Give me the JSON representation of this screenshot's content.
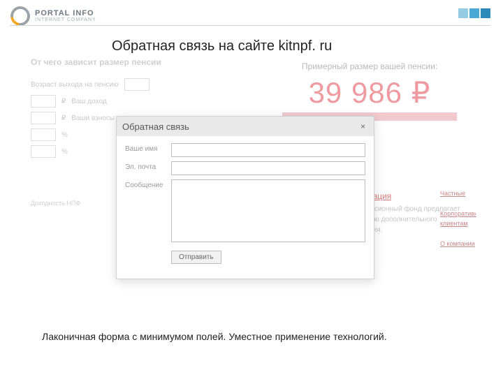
{
  "logo": {
    "main": "PORTAL INFO",
    "sub": "INTERNET COMPANY"
  },
  "title": "Обратная связь на сайте kitnpf. ru",
  "caption": "Лаконичная форма с минимумом полей. Уместное применение технологий.",
  "bg": {
    "left_heading": "От чего зависит размер пенсии",
    "left_row1_label": "Возраст выхода на пенсию",
    "left_label_salary": "Ваш доход",
    "left_label_contrib": "Ваши взносы",
    "left_footer": "Доходность НПФ",
    "right_label": "Примерный размер вашей пенсии:",
    "right_value": "39 986 ₽",
    "mid_header": "Последняя информация",
    "mid_text": "Негосударственный пенсионный фонд предлагает услуги по формированию дополнительного пенсионного обеспечения.",
    "side_a": "Частные",
    "side_b": "Корпоративным клиентам",
    "side_c": "О компании"
  },
  "modal": {
    "title": "Обратная связь",
    "name_label": "Ваше имя",
    "email_label": "Эл. почта",
    "message_label": "Сообщение",
    "submit": "Отправить"
  }
}
